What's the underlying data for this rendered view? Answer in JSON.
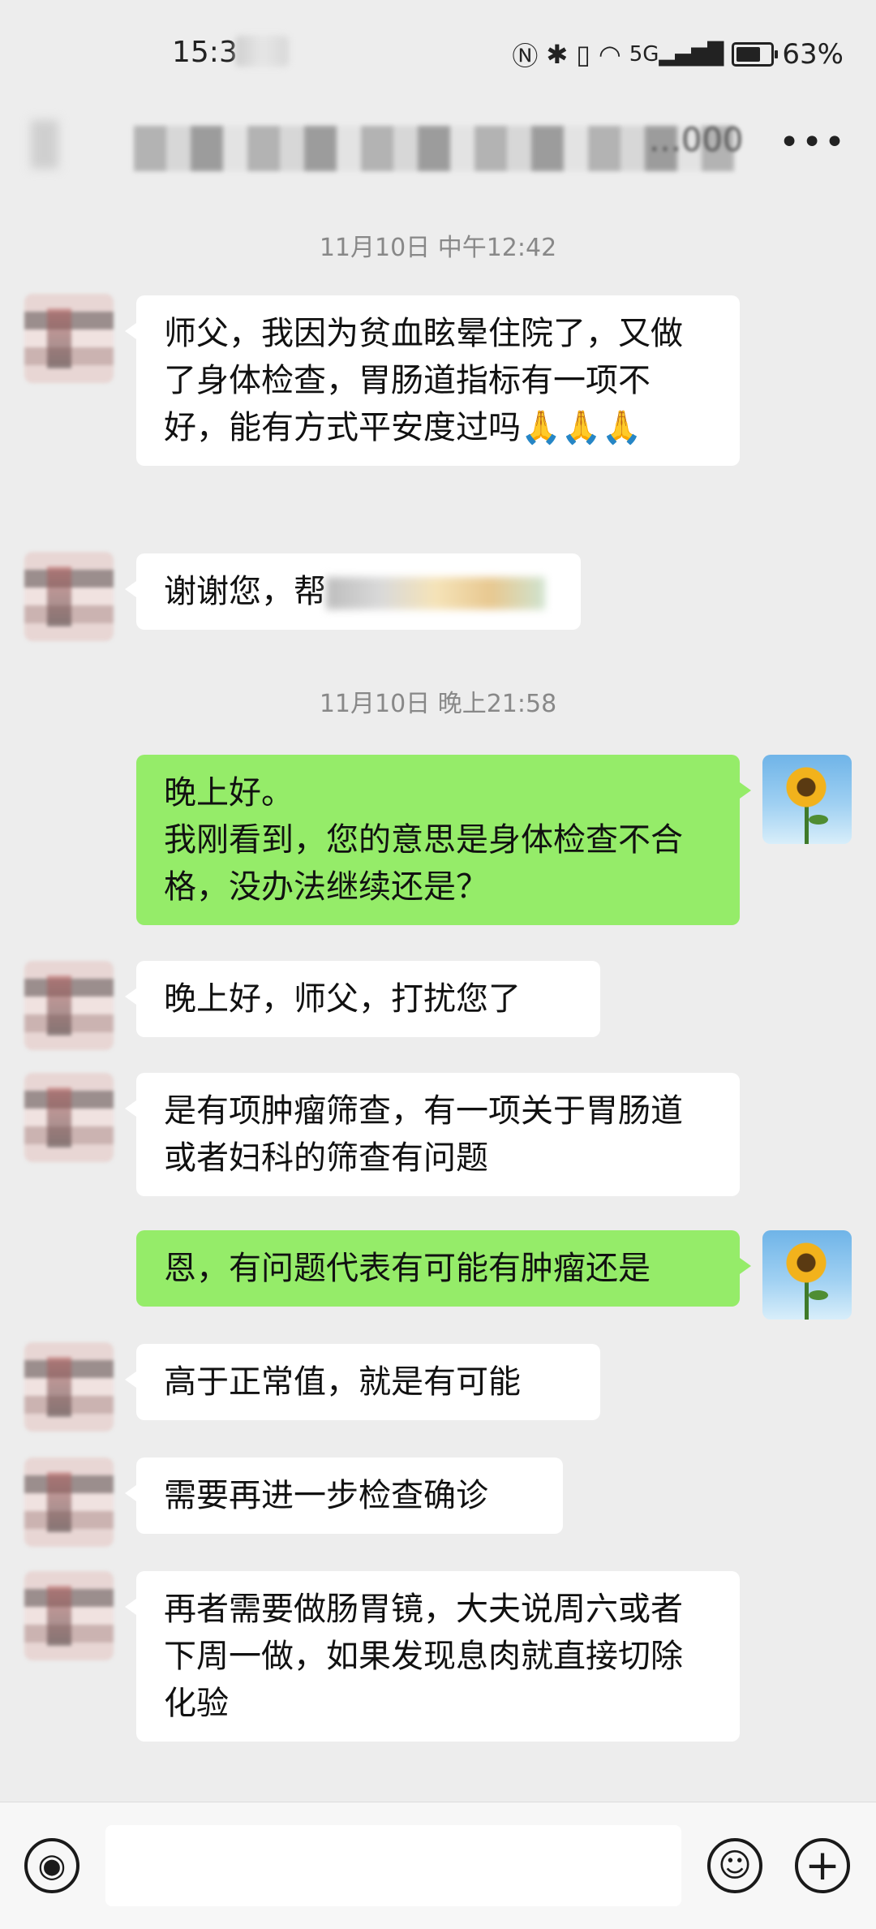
{
  "status_bar": {
    "time": "15:3",
    "battery": "63%",
    "icons": [
      "nfc-icon",
      "bluetooth-icon",
      "vibrate-icon",
      "wifi-icon",
      "signal-5g-icon",
      "battery-icon"
    ]
  },
  "header": {
    "title_visible": "…000",
    "more_label": "•••"
  },
  "messages": [
    {
      "type": "timestamp",
      "text": "11月10日 中午12:42"
    },
    {
      "type": "in",
      "text": "师父，我因为贫血眩晕住院了，又做了身体检查，胃肠道指标有一项不好，能有方式平安度过吗🙏🙏🙏"
    },
    {
      "type": "in",
      "text": "谢谢您，帮"
    },
    {
      "type": "timestamp",
      "text": "11月10日 晚上21:58"
    },
    {
      "type": "out",
      "text": "晚上好。\n我刚看到，您的意思是身体检查不合格，没办法继续还是？"
    },
    {
      "type": "in",
      "text": "晚上好，师父，打扰您了"
    },
    {
      "type": "in",
      "text": "是有项肿瘤筛查，有一项关于胃肠道或者妇科的筛查有问题"
    },
    {
      "type": "out",
      "text": "恩，有问题代表有可能有肿瘤还是"
    },
    {
      "type": "in",
      "text": "高于正常值，就是有可能"
    },
    {
      "type": "in",
      "text": "需要再进一步检查确诊"
    },
    {
      "type": "in",
      "text": "再者需要做肠胃镜，大夫说周六或者下周一做，如果发现息肉就直接切除化验"
    }
  ],
  "input_bar": {
    "voice_icon": "voice-icon",
    "emoji_icon": "emoji-icon",
    "add_icon": "plus-icon",
    "emoji_glyph": "☺",
    "add_glyph": "+",
    "voice_glyph": "◉"
  },
  "colors": {
    "background": "#ededed",
    "incoming_bubble": "#ffffff",
    "outgoing_bubble": "#95ec69",
    "timestamp_text": "#888888"
  }
}
